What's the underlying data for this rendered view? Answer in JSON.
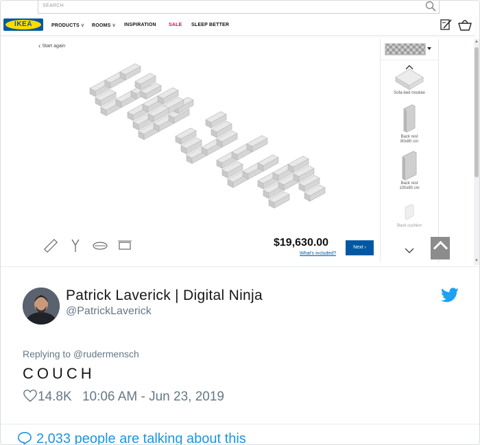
{
  "ikea": {
    "search_placeholder": "SEARCH",
    "logo_text": "IKEA",
    "nav": [
      {
        "label": "PRODUCTS",
        "color": "#111111"
      },
      {
        "label": "ROOMS",
        "color": "#111111"
      },
      {
        "label": "INSPIRATION",
        "color": "#111111"
      },
      {
        "label": "SALE",
        "color": "#e00751"
      },
      {
        "label": "SLEEP BETTER",
        "color": "#111111"
      }
    ],
    "start_again": "Start again",
    "price": "$19,630.00",
    "whats_included": "What's included?",
    "next_button": "Next",
    "modules": [
      {
        "label": "Sofa-bed module"
      },
      {
        "label": "Back rest\n80x80 cm"
      },
      {
        "label": "Back rest\n100x80 cm"
      },
      {
        "label": "Back cushion"
      }
    ],
    "brand_colors": {
      "ikea_blue": "#0058a3",
      "ikea_yellow": "#ffdb00"
    }
  },
  "tweet": {
    "author_name": "Patrick Laverick | Digital Ninja",
    "handle": "@PatrickLaverick",
    "reply_context": "Replying to @rudermensch",
    "text": "COUCH",
    "likes": "14.8K",
    "timestamp": "10:06 AM - Jun 23, 2019",
    "talking": "2,033 people are talking about this",
    "colors": {
      "link_blue": "#1b95e0",
      "twitter_bird": "#1da1f2",
      "muted": "#657786"
    }
  }
}
